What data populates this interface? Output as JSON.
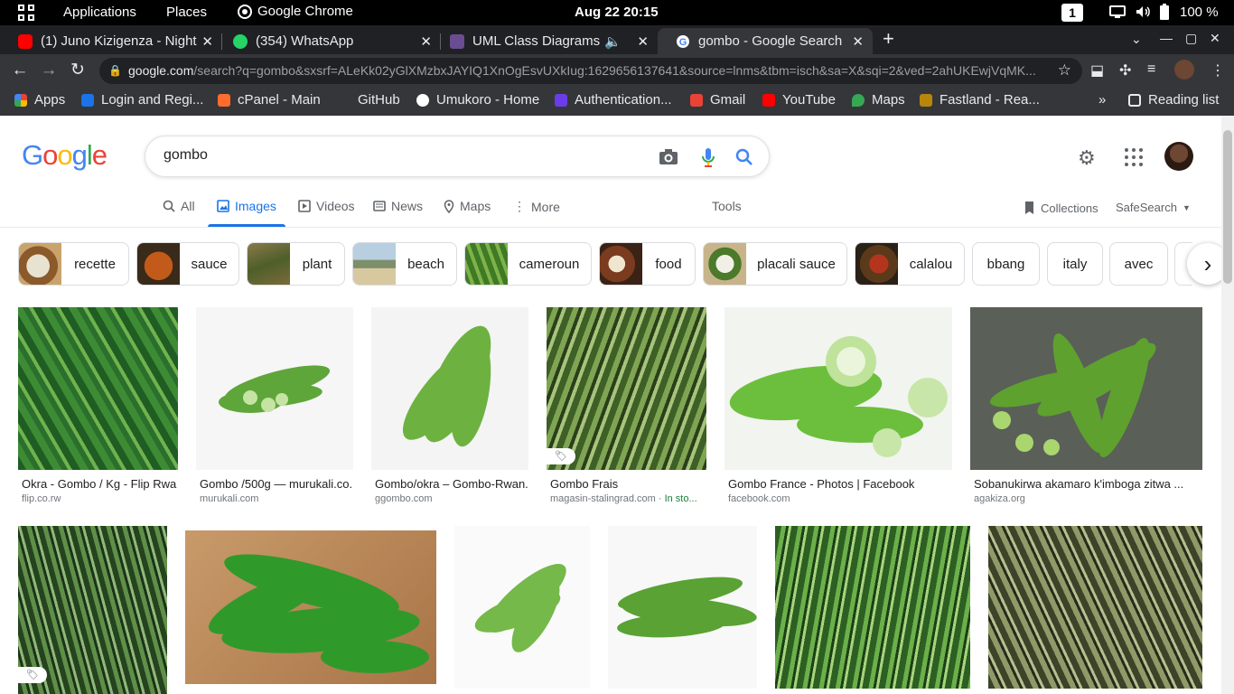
{
  "system": {
    "applications": "Applications",
    "places": "Places",
    "app_name": "Google Chrome",
    "clock": "Aug 22  20:15",
    "workspace": "1",
    "battery": "100 %"
  },
  "browser": {
    "tabs": [
      {
        "title": "(1) Juno Kizigenza - Night",
        "favicon_color": "#ff0000"
      },
      {
        "title": "(354) WhatsApp",
        "favicon_color": "#25d366"
      },
      {
        "title": "UML Class Diagrams fo",
        "favicon_color": "#6a4c93"
      },
      {
        "title": "gombo - Google Search",
        "favicon_color": "#ffffff"
      }
    ],
    "url_host": "google.com",
    "url_rest": "/search?q=gombo&sxsrf=ALeKk02yGlXMzbxJAYIQ1XnOgEsvUXkIug:1629656137641&source=lnms&tbm=isch&sa=X&sqi=2&ved=2ahUKEwjVqMK...",
    "bookmarks": [
      {
        "label": "Apps",
        "color": "#4285f4"
      },
      {
        "label": "Login and Regi...",
        "color": "#1a73e8"
      },
      {
        "label": "cPanel - Main",
        "color": "#ff6c2c"
      },
      {
        "label": "GitHub",
        "color": "#35363a"
      },
      {
        "label": "Umukoro - Home",
        "color": "#ffffff"
      },
      {
        "label": "Authentication...",
        "color": "#6a3de8"
      },
      {
        "label": "Gmail",
        "color": "#ea4335"
      },
      {
        "label": "YouTube",
        "color": "#ff0000"
      },
      {
        "label": "Maps",
        "color": "#34a853"
      },
      {
        "label": "Fastland - Rea...",
        "color": "#b8860b"
      }
    ],
    "more_bookmarks": "»",
    "reading_list": "Reading list"
  },
  "google": {
    "logo_letters": [
      "G",
      "o",
      "o",
      "g",
      "l",
      "e"
    ],
    "logo_colors": [
      "#4285f4",
      "#ea4335",
      "#fbbc05",
      "#4285f4",
      "#34a853",
      "#ea4335"
    ],
    "query": "gombo",
    "tabs": [
      {
        "label": "All",
        "icon": "search-icon"
      },
      {
        "label": "Images",
        "icon": "image-icon"
      },
      {
        "label": "Videos",
        "icon": "video-icon"
      },
      {
        "label": "News",
        "icon": "news-icon"
      },
      {
        "label": "Maps",
        "icon": "map-pin-icon"
      },
      {
        "label": "More",
        "icon": "dots-vertical-icon"
      }
    ],
    "tools": "Tools",
    "collections": "Collections",
    "safesearch": "SafeSearch",
    "chips": [
      {
        "label": "recette",
        "thumb": "#c9a36b"
      },
      {
        "label": "sauce",
        "thumb": "#b35a1f"
      },
      {
        "label": "plant",
        "thumb": "#6e7a3a"
      },
      {
        "label": "beach",
        "thumb": "#8fa9b8"
      },
      {
        "label": "cameroun",
        "thumb": "#4f8a2f"
      },
      {
        "label": "food",
        "thumb": "#7a3b1e"
      },
      {
        "label": "placali sauce",
        "thumb": "#c8b48a"
      },
      {
        "label": "calalou",
        "thumb": "#6b3a2a"
      },
      {
        "label": "bbang",
        "thumb": ""
      },
      {
        "label": "italy",
        "thumb": ""
      },
      {
        "label": "avec",
        "thumb": ""
      }
    ],
    "results_row1": [
      {
        "title": "Okra - Gombo / Kg - Flip Rwa...",
        "source": "flip.co.rw",
        "stock": "",
        "bg": "dark-pile"
      },
      {
        "title": "Gombo /500g — murukali.co...",
        "source": "murukali.com",
        "stock": "",
        "bg": "white"
      },
      {
        "title": "Gombo/okra – Gombo-Rwan...",
        "source": "ggombo.com",
        "stock": "",
        "bg": "white"
      },
      {
        "title": "Gombo Frais",
        "source": "magasin-stalingrad.com · ",
        "stock": "In sto...",
        "bg": "dark-pile"
      },
      {
        "title": "Gombo France - Photos | Facebook",
        "source": "facebook.com",
        "stock": "",
        "bg": "white"
      },
      {
        "title": "Sobanukirwa akamaro k'imboga zitwa ...",
        "source": "agakiza.org",
        "stock": "",
        "bg": "gray"
      }
    ],
    "results_row2": [
      {
        "bg": "dark-pile"
      },
      {
        "bg": "wood"
      },
      {
        "bg": "white"
      },
      {
        "bg": "white"
      },
      {
        "bg": "dark-pile"
      },
      {
        "bg": "olive-pile"
      }
    ]
  }
}
